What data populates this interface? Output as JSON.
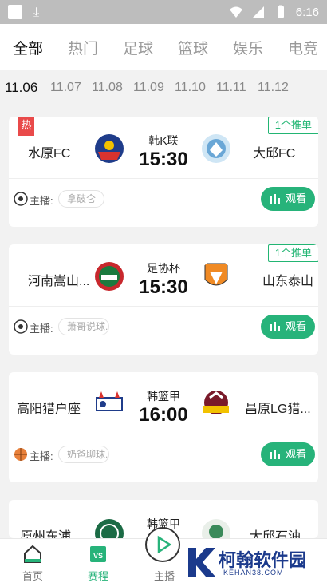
{
  "status_bar": {
    "time": "6:16"
  },
  "category_tabs": [
    "全部",
    "热门",
    "足球",
    "篮球",
    "娱乐",
    "电竞"
  ],
  "date_tabs": [
    "11.06",
    "11.07",
    "11.08",
    "11.09",
    "11.10",
    "11.11",
    "11.12"
  ],
  "matches": [
    {
      "hot_tag": "热",
      "tip_badge": "1个推单",
      "home": "水原FC",
      "away": "大邱FC",
      "league": "韩K联",
      "time": "15:30",
      "anchor_label": "主播:",
      "anchor_name": "拿破仑",
      "watch_label": "观看",
      "sport_icon": "soccer-ball-icon"
    },
    {
      "hot_tag": "",
      "tip_badge": "1个推单",
      "home": "河南嵩山...",
      "away": "山东泰山",
      "league": "足协杯",
      "time": "15:30",
      "anchor_label": "主播:",
      "anchor_name": "萧哥说球...",
      "watch_label": "观看",
      "sport_icon": "soccer-ball-icon"
    },
    {
      "hot_tag": "",
      "tip_badge": "",
      "home": "高阳猎户座",
      "away": "昌原LG猎...",
      "league": "韩篮甲",
      "time": "16:00",
      "anchor_label": "主播:",
      "anchor_name": "奶爸聊球...",
      "watch_label": "观看",
      "sport_icon": "basketball-icon"
    },
    {
      "hot_tag": "",
      "tip_badge": "",
      "home": "原州东浦...",
      "away": "大邱石油...",
      "league": "韩篮甲",
      "time": "",
      "anchor_label": "",
      "anchor_name": "",
      "watch_label": "",
      "sport_icon": ""
    }
  ],
  "bottom_nav": [
    {
      "label": "首页",
      "icon": "home-icon"
    },
    {
      "label": "赛程",
      "icon": "schedule-vs-icon"
    },
    {
      "label": "主播",
      "icon": "play-icon"
    }
  ],
  "watermark": {
    "text": "柯翰软件园",
    "url": "KEHAN38.COM"
  },
  "colors": {
    "accent": "#27b37a",
    "hot": "#e94a4a",
    "watermark": "#1b3a8c"
  }
}
